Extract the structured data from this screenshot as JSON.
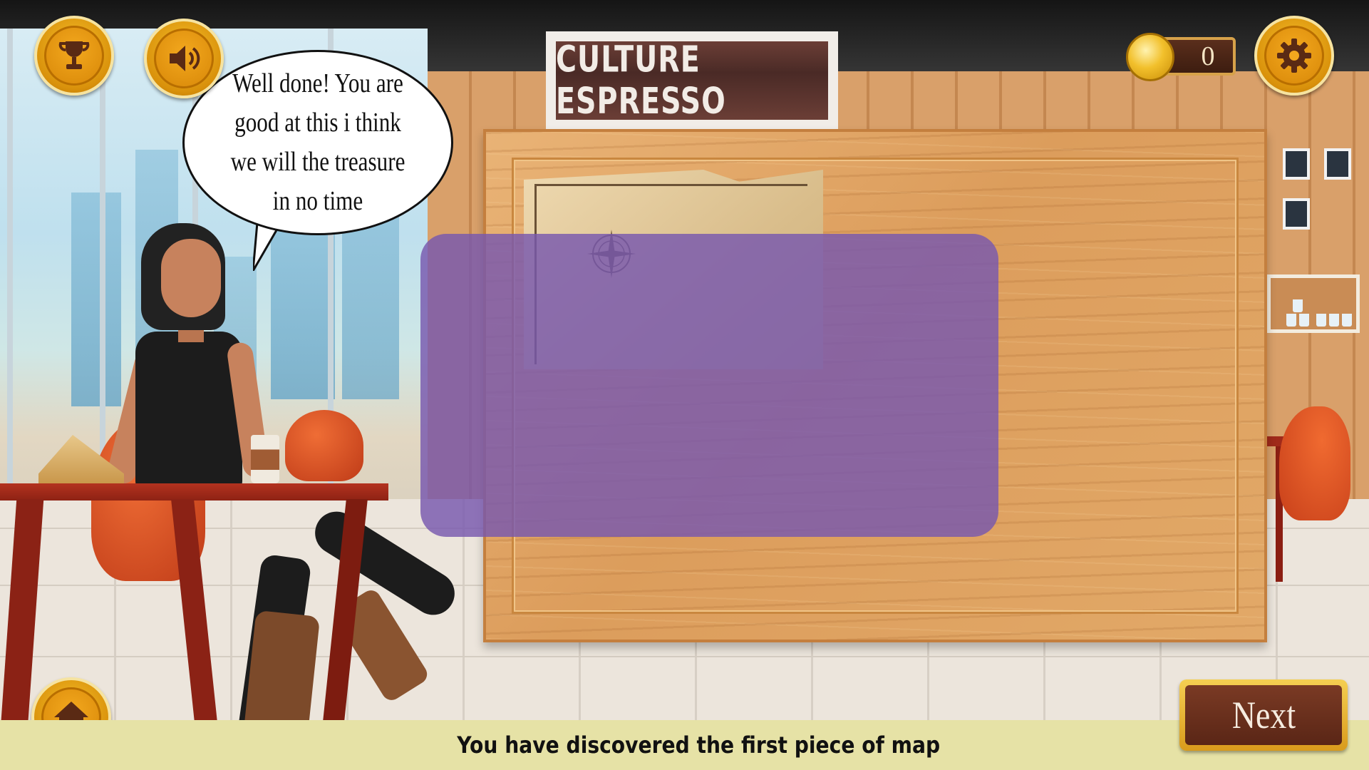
{
  "sign": {
    "text": "CULTURE ESPRESSO"
  },
  "dialogue": {
    "speech": "Well done! You are good at this i think we will the treasure in no time"
  },
  "hud": {
    "trophy_icon": "trophy-icon",
    "sound_icon": "speaker-icon",
    "settings_icon": "gear-icon",
    "home_icon": "home-icon",
    "coin_icon": "coin-icon",
    "coins": "0"
  },
  "navigation": {
    "next_label": "Next"
  },
  "status": {
    "message": "You have discovered the first piece of map"
  },
  "colors": {
    "button_gold": "#f6c02a",
    "overlay_purple": "#7858af",
    "board_wood": "#dc9d5c",
    "next_brown": "#6a2e1c",
    "status_bar": "#e6e2a6"
  }
}
